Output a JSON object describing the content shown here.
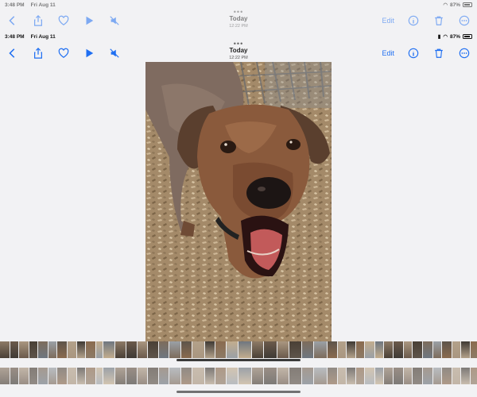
{
  "status": {
    "time": "3:48 PM",
    "date": "Fri Aug 11",
    "battery": "87%",
    "battery_level": 0.87
  },
  "toolbar": {
    "title": "Today",
    "subtitle": "12:22 PM",
    "edit_label": "Edit",
    "icons": [
      "back-chevron-icon",
      "share-icon",
      "heart-icon",
      "play-icon",
      "mute-icon",
      "info-icon",
      "trash-icon",
      "more-icon"
    ]
  },
  "colors": {
    "accent": "#1f6ff2",
    "background": "#f2f2f4"
  }
}
